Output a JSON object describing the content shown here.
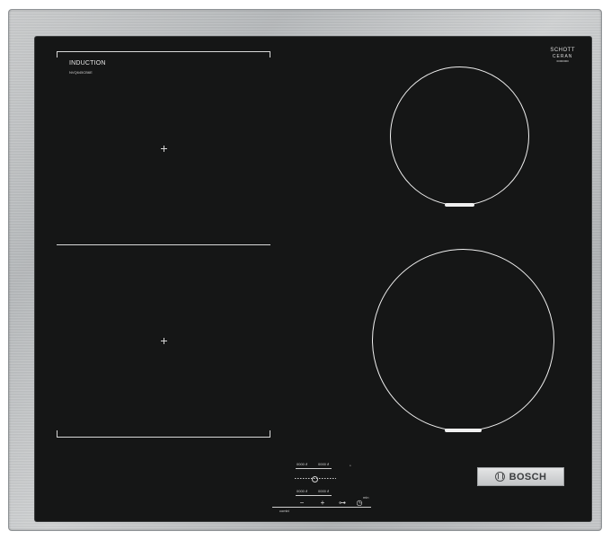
{
  "hob": {
    "label": "INDUCTION",
    "model": "NVQ645CB6E",
    "glass_brand": {
      "line1": "SCHOTT",
      "line2": "CERAN",
      "line3": "00000000"
    },
    "brand": "BOSCH"
  },
  "controls": {
    "zone_labels": [
      "0000 ∂",
      "0000 ∂",
      "0000 ∂",
      "0000 ∂"
    ],
    "lock_symbol": "ᵒ",
    "min_label": "min",
    "combi_label": "combi",
    "buttons": [
      "−",
      "+",
      "⊶",
      "◷"
    ]
  },
  "colors": {
    "glass": "#151616",
    "frame": "#bfc1c3",
    "marking": "#f0f0f0"
  }
}
